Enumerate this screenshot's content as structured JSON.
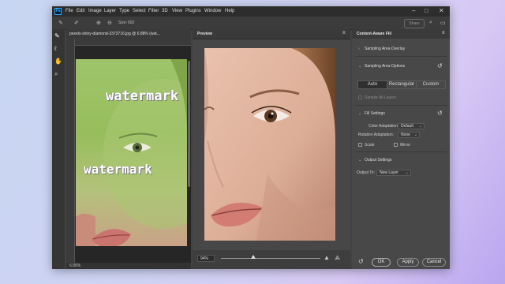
{
  "menubar": {
    "logo": "Ps",
    "items": [
      "File",
      "Edit",
      "Image",
      "Layer",
      "Type",
      "Select",
      "Filter",
      "3D",
      "View",
      "Plugins",
      "Window",
      "Help"
    ],
    "controls": [
      "–",
      "□",
      "✕"
    ]
  },
  "options_bar": {
    "size_label": "Size:",
    "size_value": "602",
    "share_label": "Share"
  },
  "toolbar": {
    "tools": [
      "brush-icon",
      "lasso-icon",
      "hand-icon",
      "zoom-icon"
    ]
  },
  "document": {
    "tab_title": "pexels-shiny-diamond-3373716.jpg @ 6.88% (wat...",
    "watermark_1": "watermark",
    "watermark_2": "watermark",
    "status_zoom": "6.88%"
  },
  "preview": {
    "tab_title": "Preview",
    "zoom_value": "94%"
  },
  "panel": {
    "title": "Content-Aware Fill",
    "sampling_overlay": "Sampling Area Overlay",
    "sampling_options": "Sampling Area Options",
    "segments": [
      "Auto",
      "Rectangular",
      "Custom"
    ],
    "sample_all_layers": "Sample All Layers",
    "fill_settings": "Fill Settings",
    "color_adaptation_label": "Color Adaptation:",
    "color_adaptation_value": "Default",
    "rotation_adaptation_label": "Rotation Adaptation:",
    "rotation_adaptation_value": "None",
    "scale_label": "Scale",
    "mirror_label": "Mirror",
    "output_settings": "Output Settings",
    "output_to_label": "Output To:",
    "output_to_value": "New Layer"
  },
  "buttons": {
    "ok": "OK",
    "apply": "Apply",
    "cancel": "Cancel"
  }
}
